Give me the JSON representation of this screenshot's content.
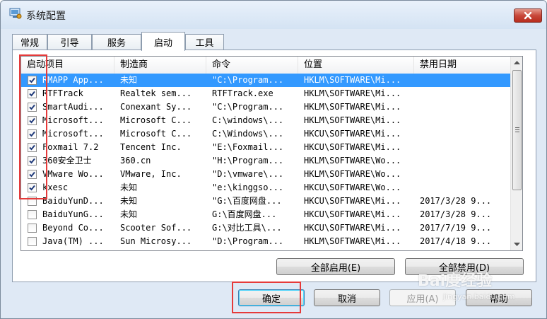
{
  "window": {
    "title": "系统配置"
  },
  "tabs": [
    {
      "label": "常规"
    },
    {
      "label": "引导"
    },
    {
      "label": "服务"
    },
    {
      "label": "启动"
    },
    {
      "label": "工具"
    }
  ],
  "active_tab": "启动",
  "table": {
    "columns": [
      "启动项目",
      "制造商",
      "命令",
      "位置",
      "禁用日期"
    ],
    "rows": [
      {
        "checked": true,
        "item": "RMAPP App...",
        "maker": "未知",
        "command": "\"C:\\Program...",
        "location": "HKLM\\SOFTWARE\\Mi...",
        "date": ""
      },
      {
        "checked": true,
        "item": "RTFTrack",
        "maker": "Realtek sem...",
        "command": "RTFTrack.exe",
        "location": "HKLM\\SOFTWARE\\Mi...",
        "date": ""
      },
      {
        "checked": true,
        "item": "SmartAudi...",
        "maker": "Conexant Sy...",
        "command": "\"C:\\Program...",
        "location": "HKLM\\SOFTWARE\\Mi...",
        "date": ""
      },
      {
        "checked": true,
        "item": "Microsoft...",
        "maker": "Microsoft C...",
        "command": "C:\\windows\\...",
        "location": "HKLM\\SOFTWARE\\Mi...",
        "date": ""
      },
      {
        "checked": true,
        "item": "Microsoft...",
        "maker": "Microsoft C...",
        "command": "C:\\Windows\\...",
        "location": "HKCU\\SOFTWARE\\Mi...",
        "date": ""
      },
      {
        "checked": true,
        "item": "Foxmail 7.2",
        "maker": "Tencent Inc.",
        "command": "\"E:\\Foxmail...",
        "location": "HKCU\\SOFTWARE\\Mi...",
        "date": ""
      },
      {
        "checked": true,
        "item": "360安全卫士",
        "maker": "360.cn",
        "command": "\"H:\\Program...",
        "location": "HKLM\\SOFTWARE\\Wo...",
        "date": ""
      },
      {
        "checked": true,
        "item": "VMware Wo...",
        "maker": "VMware, Inc.",
        "command": "\"D:\\vmware\\...",
        "location": "HKLM\\SOFTWARE\\Wo...",
        "date": ""
      },
      {
        "checked": true,
        "item": "kxesc",
        "maker": "未知",
        "command": "\"e:\\kinggso...",
        "location": "HKCU\\SOFTWARE\\Wo...",
        "date": ""
      },
      {
        "checked": false,
        "item": "BaiduYunD...",
        "maker": "未知",
        "command": "\"G:\\百度网盘...",
        "location": "HKCU\\SOFTWARE\\Mi...",
        "date": "2017/3/28 9..."
      },
      {
        "checked": false,
        "item": "BaiduYunG...",
        "maker": "未知",
        "command": "G:\\百度网盘...",
        "location": "HKCU\\SOFTWARE\\Mi...",
        "date": "2017/3/28 9..."
      },
      {
        "checked": false,
        "item": "Beyond Co...",
        "maker": "Scooter Sof...",
        "command": "G:\\对比工具\\...",
        "location": "HKCU\\SOFTWARE\\Mi...",
        "date": "2017/7/19 9..."
      },
      {
        "checked": false,
        "item": "Java(TM) ...",
        "maker": "Sun Microsy...",
        "command": "\"D:\\Program...",
        "location": "HKLM\\SOFTWARE\\Mi...",
        "date": "2017/4/18 9..."
      }
    ]
  },
  "buttons": {
    "enable_all": "全部启用(E)",
    "disable_all": "全部禁用(D)",
    "ok": "确定",
    "cancel": "取消",
    "apply": "应用(A)",
    "help": "帮助"
  },
  "watermark": {
    "main": "Bai度经验",
    "sub": "jingyan.baidu.com"
  },
  "colors": {
    "selection": "#3399ff",
    "highlight_box": "#e53a3a"
  }
}
